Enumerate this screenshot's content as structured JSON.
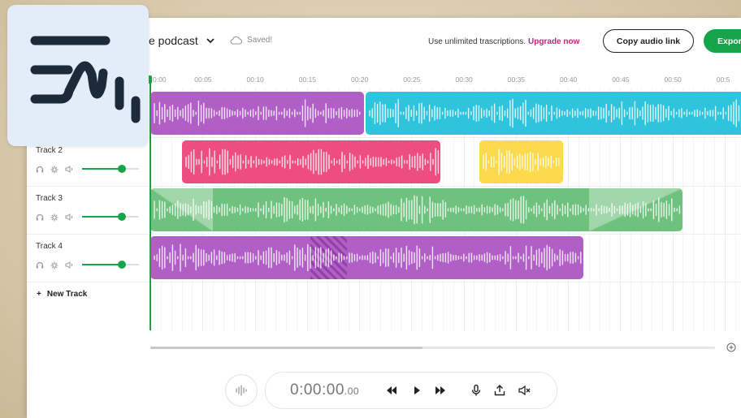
{
  "header": {
    "project_title": "e podcast",
    "saved_label": "Saved!",
    "promo_text": "Use unlimited trascriptions.",
    "upgrade_label": "Upgrade now",
    "copy_link_label": "Copy audio link",
    "export_label": "Expor"
  },
  "ruler": {
    "ticks": [
      "0:00",
      "00:05",
      "00:10",
      "00:15",
      "00:20",
      "00:25",
      "00:30",
      "00:35",
      "00:40",
      "00:45",
      "00:50",
      "00:5"
    ]
  },
  "tracks": [
    {
      "name": "",
      "volume": 0.7
    },
    {
      "name": "Track 2",
      "volume": 0.7
    },
    {
      "name": "Track 3",
      "volume": 0.7
    },
    {
      "name": "Track 4",
      "volume": 0.7
    }
  ],
  "new_track_label": "New Track",
  "clips": [
    {
      "track": 0,
      "start": 0.0,
      "end": 20.5,
      "color": "#b05fc7"
    },
    {
      "track": 0,
      "start": 20.6,
      "end": 57.0,
      "color": "#2ec4de"
    },
    {
      "track": 1,
      "start": 3.0,
      "end": 27.8,
      "color": "#ee4d7f"
    },
    {
      "track": 1,
      "start": 31.5,
      "end": 39.5,
      "color": "#fdd94d"
    },
    {
      "track": 2,
      "start": 0.0,
      "end": 51.0,
      "color": "#6fc17e",
      "fade_in": 6.0,
      "fade_out": 9.0
    },
    {
      "track": 3,
      "start": 0.0,
      "end": 41.5,
      "color": "#b05fc7",
      "hatch_start": 15.3,
      "hatch_end": 18.8
    }
  ],
  "transport": {
    "time_main": "0:00:00",
    "time_ms": ".00"
  },
  "colors": {
    "accent": "#17a34a",
    "upgrade": "#c2277d"
  }
}
